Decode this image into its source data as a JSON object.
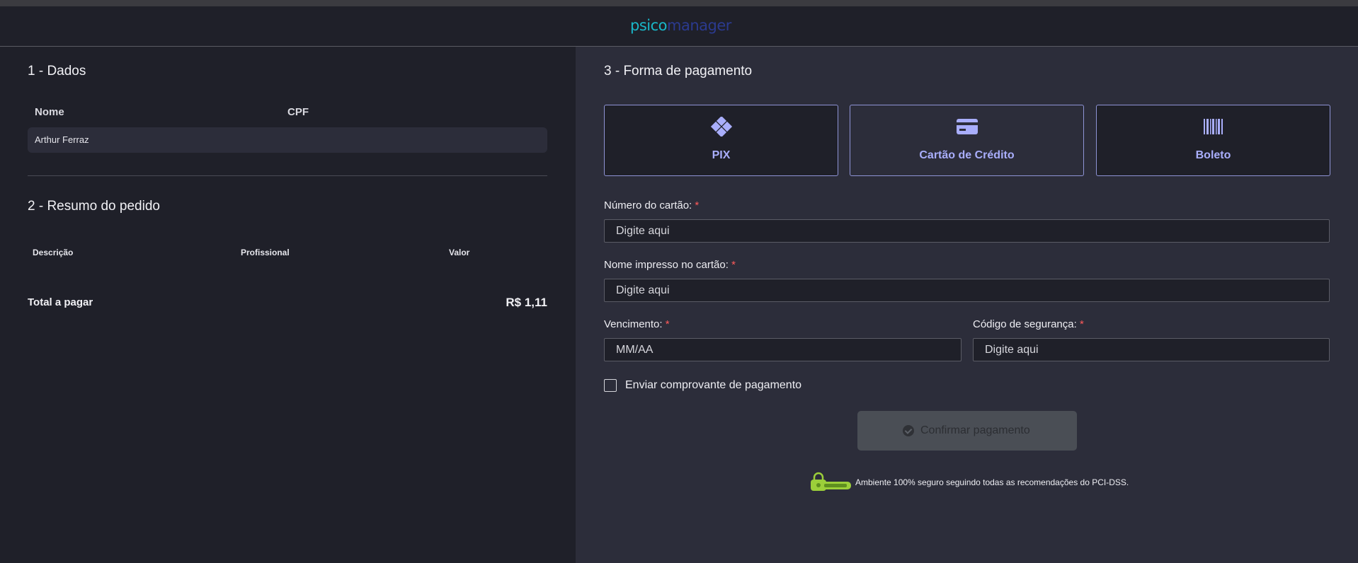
{
  "brand": {
    "logo_part1": "psico",
    "logo_part2": "manager"
  },
  "dados": {
    "title": "1 - Dados",
    "col_nome": "Nome",
    "col_cpf": "CPF",
    "nome_value": "Arthur Ferraz"
  },
  "resumo": {
    "title": "2 - Resumo do pedido",
    "columns": [
      "Descrição",
      "Profissional",
      "Valor"
    ],
    "total_label": "Total a pagar",
    "total_value": "R$ 1,11"
  },
  "pagamento": {
    "title": "3 - Forma de pagamento",
    "methods": [
      {
        "label": "PIX",
        "icon": "pix-icon"
      },
      {
        "label": "Cartão de Crédito",
        "icon": "credit-card-icon",
        "selected": true
      },
      {
        "label": "Boleto",
        "icon": "barcode-icon"
      }
    ],
    "fields": {
      "card_number_label": "Número do cartão:",
      "card_number_placeholder": "Digite aqui",
      "card_name_label": "Nome impresso no cartão:",
      "card_name_placeholder": "Digite aqui",
      "expiry_label": "Vencimento:",
      "expiry_placeholder": "MM/AA",
      "cvv_label": "Código de segurança:",
      "cvv_placeholder": "Digite aqui",
      "required_mark": "*"
    },
    "send_receipt_label": "Enviar comprovante de pagamento",
    "confirm_label": "Confirmar pagamento",
    "secure_text": "Ambiente 100% seguro seguindo todas as recomendações do PCI-DSS."
  },
  "colors": {
    "accent": "#a9aefc",
    "background_left": "#1f2029",
    "background_right": "#2c2d3a",
    "required": "#ff5a5a"
  }
}
